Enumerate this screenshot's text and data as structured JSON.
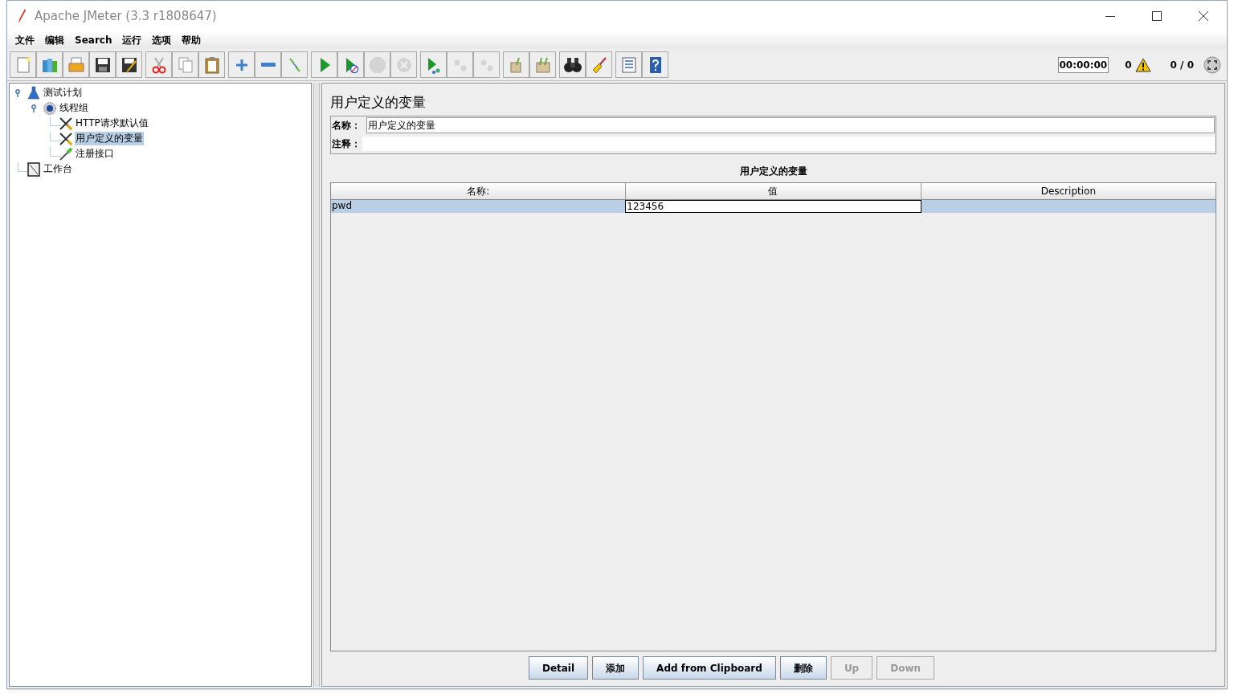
{
  "window": {
    "title": "Apache JMeter (3.3 r1808647)"
  },
  "menu": [
    "文件",
    "编辑",
    "Search",
    "运行",
    "选项",
    "帮助"
  ],
  "toolbar": [
    [
      {
        "kind": "new",
        "disabled": false
      },
      {
        "kind": "templates",
        "disabled": false
      },
      {
        "kind": "open",
        "disabled": false
      },
      {
        "kind": "save",
        "disabled": false
      },
      {
        "kind": "save-as",
        "disabled": false
      }
    ],
    [
      {
        "kind": "cut",
        "disabled": false
      },
      {
        "kind": "copy",
        "disabled": false
      },
      {
        "kind": "paste",
        "disabled": false
      }
    ],
    [
      {
        "kind": "expand",
        "disabled": false
      },
      {
        "kind": "collapse",
        "disabled": false
      },
      {
        "kind": "toggle",
        "disabled": false
      }
    ],
    [
      {
        "kind": "start",
        "disabled": false
      },
      {
        "kind": "start-no-pause",
        "disabled": false
      },
      {
        "kind": "stop",
        "disabled": true
      },
      {
        "kind": "shutdown",
        "disabled": true
      }
    ],
    [
      {
        "kind": "remote-start",
        "disabled": false
      },
      {
        "kind": "remote-stop",
        "disabled": true
      },
      {
        "kind": "remote-exit",
        "disabled": true
      }
    ],
    [
      {
        "kind": "clear",
        "disabled": false
      },
      {
        "kind": "clear-all",
        "disabled": false
      }
    ],
    [
      {
        "kind": "search",
        "disabled": false
      },
      {
        "kind": "reset-search",
        "disabled": false
      }
    ],
    [
      {
        "kind": "function-helper",
        "disabled": false
      },
      {
        "kind": "help",
        "disabled": false
      }
    ]
  ],
  "status": {
    "timer": "00:00:00",
    "warnings": "0",
    "threads": "0 / 0"
  },
  "tree": [
    {
      "label": "测试计划",
      "kind": "plan",
      "selected": false,
      "expanded": true,
      "children": [
        {
          "label": "线程组",
          "kind": "thread-group",
          "selected": false,
          "expanded": true,
          "children": [
            {
              "label": "HTTP请求默认值",
              "kind": "config",
              "selected": false
            },
            {
              "label": "用户定义的变量",
              "kind": "config",
              "selected": true
            },
            {
              "label": "注册接口",
              "kind": "sampler",
              "selected": false
            }
          ]
        }
      ]
    },
    {
      "label": "工作台",
      "kind": "workbench",
      "selected": false
    }
  ],
  "panel": {
    "title": "用户定义的变量",
    "name_label": "名称：",
    "name_value": "用户定义的变量",
    "comment_label": "注释：",
    "table": {
      "title": "用户定义的变量",
      "columns": [
        "名称:",
        "值",
        "Description"
      ],
      "rows": [
        {
          "selected": true,
          "cells": [
            {
              "text": "pwd",
              "editing": false
            },
            {
              "text": "123456",
              "editing": true
            }
          ]
        }
      ]
    },
    "buttons": [
      {
        "label": "Detail",
        "disabled": false
      },
      {
        "label": "添加",
        "disabled": false
      },
      {
        "label": "Add from Clipboard",
        "disabled": false
      },
      {
        "label": "删除",
        "disabled": false
      },
      {
        "label": "Up",
        "disabled": true
      },
      {
        "label": "Down",
        "disabled": true
      }
    ]
  }
}
